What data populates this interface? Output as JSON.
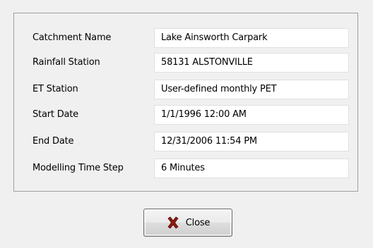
{
  "fields": [
    {
      "label": "Catchment Name",
      "value": "Lake Ainsworth Carpark"
    },
    {
      "label": "Rainfall Station",
      "value": "58131 ALSTONVILLE"
    },
    {
      "label": "ET Station",
      "value": "User-defined monthly PET"
    },
    {
      "label": "Start Date",
      "value": "1/1/1996 12:00 AM"
    },
    {
      "label": "End Date",
      "value": "12/31/2006 11:54 PM"
    },
    {
      "label": "Modelling Time Step",
      "value": "6 Minutes"
    }
  ],
  "close_button": {
    "label": "Close",
    "icon": "close-icon",
    "icon_color": "#8b1a10"
  }
}
